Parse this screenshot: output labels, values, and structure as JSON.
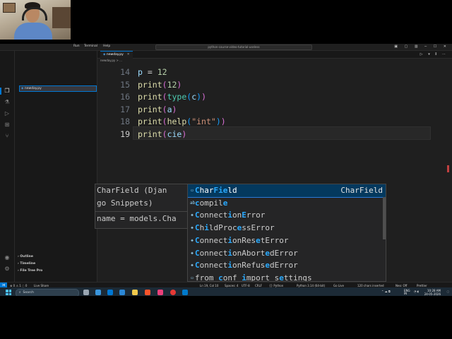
{
  "window": {
    "menu": [
      "Run",
      "Terminal",
      "Help"
    ],
    "command_center": "python-course-video-tutorial-useless",
    "active_tab": "newday.py",
    "breadcrumb": "newday.py  >  ..."
  },
  "sidebar": {
    "active_file": "newday.py",
    "sections": [
      "Outline",
      "Timeline",
      "File Tree Pro"
    ]
  },
  "editor": {
    "lines": [
      {
        "num": "14",
        "tokens": [
          [
            "var",
            "p"
          ],
          [
            "op",
            " = "
          ],
          [
            "num",
            "12"
          ]
        ]
      },
      {
        "num": "15",
        "tokens": [
          [
            "fn",
            "print"
          ],
          [
            "par",
            "("
          ],
          [
            "num",
            "12"
          ],
          [
            "par",
            ")"
          ]
        ]
      },
      {
        "num": "16",
        "tokens": [
          [
            "fn",
            "print"
          ],
          [
            "par",
            "("
          ],
          [
            "bi",
            "type"
          ],
          [
            "par2",
            "("
          ],
          [
            "var",
            "c"
          ],
          [
            "par2",
            ")"
          ],
          [
            "par",
            ")"
          ]
        ]
      },
      {
        "num": "17",
        "tokens": [
          [
            "fn",
            "print"
          ],
          [
            "par",
            "("
          ],
          [
            "var",
            "a"
          ],
          [
            "par",
            ")"
          ]
        ]
      },
      {
        "num": "18",
        "tokens": [
          [
            "fn",
            "print"
          ],
          [
            "par",
            "("
          ],
          [
            "fn",
            "help"
          ],
          [
            "par2",
            "("
          ],
          [
            "str",
            "\"int\""
          ],
          [
            "par2",
            ")"
          ],
          [
            "par",
            ")"
          ]
        ]
      },
      {
        "num": "19",
        "tokens": [
          [
            "fn",
            "print"
          ],
          [
            "par",
            "("
          ],
          [
            "var",
            "cie"
          ],
          [
            "par",
            ")"
          ]
        ]
      }
    ],
    "current_line": "19"
  },
  "hover_doc": {
    "line1": "CharField (Djan",
    "line2": "go Snippets)",
    "line3": "name = models.Cha"
  },
  "suggestions": {
    "items": [
      {
        "parts": [
          [
            "h",
            "C"
          ],
          [
            "n",
            "har"
          ],
          [
            "h",
            "Fie"
          ],
          [
            "n",
            "ld"
          ]
        ],
        "detail": "CharField",
        "icon": "snippet-icon",
        "selected": true
      },
      {
        "parts": [
          [
            "h",
            "c"
          ],
          [
            "n",
            "ompil"
          ],
          [
            "h",
            "e"
          ]
        ],
        "detail": "",
        "icon": "word-icon"
      },
      {
        "parts": [
          [
            "h",
            "C"
          ],
          [
            "n",
            "onnect"
          ],
          [
            "h",
            "i"
          ],
          [
            "n",
            "on"
          ],
          [
            "h",
            "E"
          ],
          [
            "n",
            "rror"
          ]
        ],
        "detail": "",
        "icon": "class-icon"
      },
      {
        "parts": [
          [
            "h",
            "C"
          ],
          [
            "n",
            "h"
          ],
          [
            "h",
            "i"
          ],
          [
            "n",
            "ldProc"
          ],
          [
            "h",
            "e"
          ],
          [
            "n",
            "ssError"
          ]
        ],
        "detail": "",
        "icon": "class-icon"
      },
      {
        "parts": [
          [
            "h",
            "C"
          ],
          [
            "n",
            "onnect"
          ],
          [
            "h",
            "i"
          ],
          [
            "n",
            "onRes"
          ],
          [
            "h",
            "e"
          ],
          [
            "n",
            "tError"
          ]
        ],
        "detail": "",
        "icon": "class-icon"
      },
      {
        "parts": [
          [
            "h",
            "C"
          ],
          [
            "n",
            "onnect"
          ],
          [
            "h",
            "i"
          ],
          [
            "n",
            "onAbort"
          ],
          [
            "h",
            "e"
          ],
          [
            "n",
            "dError"
          ]
        ],
        "detail": "",
        "icon": "class-icon"
      },
      {
        "parts": [
          [
            "h",
            "C"
          ],
          [
            "n",
            "onnect"
          ],
          [
            "h",
            "i"
          ],
          [
            "n",
            "onRefus"
          ],
          [
            "h",
            "e"
          ],
          [
            "n",
            "dError"
          ]
        ],
        "detail": "",
        "icon": "class-icon"
      },
      {
        "parts": [
          [
            "n",
            "from "
          ],
          [
            "h",
            "c"
          ],
          [
            "n",
            "onf "
          ],
          [
            "h",
            "i"
          ],
          [
            "n",
            "mport s"
          ],
          [
            "h",
            "e"
          ],
          [
            "n",
            "ttings"
          ]
        ],
        "detail": "",
        "icon": "snippet-icon"
      }
    ]
  },
  "statusbar": {
    "left": [
      "⊗ 0 ⚠ 1 ◌ 0",
      "Live Share"
    ],
    "right": [
      "Ln 19, Col 10",
      "Spaces: 4",
      "UTF-8",
      "CRLF",
      "{} Python",
      "Python 3.14 (64-bit)",
      "Go Live",
      "120 chars inserted",
      "Prettier",
      "Neo: Off"
    ]
  },
  "taskbar": {
    "search_placeholder": "Search",
    "tray_lang": "ENG",
    "tray_region": "IN",
    "time": "10:28 AM",
    "date": "24-05-2026"
  }
}
